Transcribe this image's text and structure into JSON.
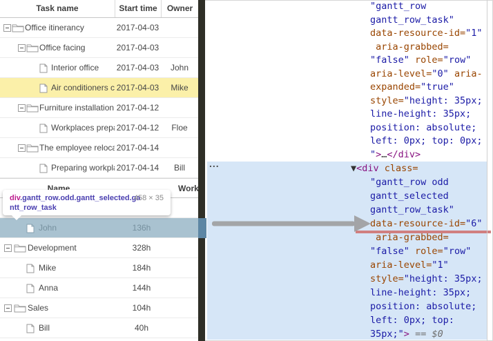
{
  "grid1": {
    "headers": [
      "Task name",
      "Start time",
      "Owner"
    ],
    "rows": [
      {
        "name": "Office itinerancy",
        "level": 0,
        "kind": "folder",
        "start": "2017-04-03",
        "owner": ""
      },
      {
        "name": "Office facing",
        "level": 1,
        "kind": "folder",
        "start": "2017-04-03",
        "owner": ""
      },
      {
        "name": "Interior office",
        "level": 2,
        "kind": "file",
        "start": "2017-04-03",
        "owner": "John"
      },
      {
        "name": "Air conditioners check",
        "level": 2,
        "kind": "file",
        "start": "2017-04-03",
        "owner": "Mike",
        "highlighted": true
      },
      {
        "name": "Furniture installation",
        "level": 1,
        "kind": "folder",
        "start": "2017-04-12",
        "owner": ""
      },
      {
        "name": "Workplaces preparation",
        "level": 2,
        "kind": "file",
        "start": "2017-04-12",
        "owner": "Floe"
      },
      {
        "name": "The employee relocation",
        "level": 1,
        "kind": "folder",
        "start": "2017-04-14",
        "owner": ""
      },
      {
        "name": "Preparing workplace",
        "level": 2,
        "kind": "file",
        "start": "2017-04-14",
        "owner": "Bill"
      }
    ]
  },
  "grid2": {
    "headers": [
      "Name",
      "Workload"
    ],
    "rows": [
      {
        "name": "",
        "kind": "empty",
        "workload": ""
      },
      {
        "name": "John",
        "kind": "file",
        "workload": "136h",
        "selected": true
      },
      {
        "name": "Development",
        "kind": "folder",
        "workload": "328h"
      },
      {
        "name": "Mike",
        "kind": "file",
        "workload": "184h"
      },
      {
        "name": "Anna",
        "kind": "file",
        "workload": "144h"
      },
      {
        "name": "Sales",
        "kind": "folder",
        "workload": "104h"
      },
      {
        "name": "Bill",
        "kind": "file",
        "workload": "40h"
      }
    ]
  },
  "inspect_tooltip": {
    "tag": "div",
    "classes_line1": ".gantt_row.odd.gantt_selected.ga",
    "classes_line2": "ntt_row_task",
    "dimensions": "458 × 35"
  },
  "devtools": {
    "ellipsis": "...",
    "node_above_lines": [
      [
        {
          "t": "\"gantt_row",
          "c": "val"
        }
      ],
      [
        {
          "t": "gantt_row_task\"",
          "c": "val"
        }
      ],
      [
        {
          "t": "data-resource-id=",
          "c": "attr"
        },
        {
          "t": "\"1\"",
          "c": "val"
        }
      ],
      [
        {
          "t": " aria-grabbed=",
          "c": "attr"
        }
      ],
      [
        {
          "t": "\"false\"",
          "c": "val"
        },
        {
          "t": " ",
          "c": "plain"
        },
        {
          "t": "role=",
          "c": "attr"
        },
        {
          "t": "\"row\"",
          "c": "val"
        }
      ],
      [
        {
          "t": "aria-level=",
          "c": "attr"
        },
        {
          "t": "\"0\"",
          "c": "val"
        },
        {
          "t": " ",
          "c": "plain"
        },
        {
          "t": "aria-",
          "c": "attr"
        }
      ],
      [
        {
          "t": "expanded=",
          "c": "attr"
        },
        {
          "t": "\"true\"",
          "c": "val"
        }
      ],
      [
        {
          "t": "style=",
          "c": "attr"
        },
        {
          "t": "\"height: 35px;",
          "c": "val"
        }
      ],
      [
        {
          "t": "line-height: 35px;",
          "c": "val"
        }
      ],
      [
        {
          "t": "position: absolute;",
          "c": "val"
        }
      ],
      [
        {
          "t": "left: 0px; top: 0px;",
          "c": "val"
        }
      ],
      [
        {
          "t": "\"",
          "c": "val"
        },
        {
          "t": ">",
          "c": "tag"
        },
        {
          "t": "…",
          "c": "plain"
        },
        {
          "t": "</div>",
          "c": "tag"
        }
      ]
    ],
    "selected_node_lines": [
      [
        {
          "t": "▼",
          "c": "plain"
        },
        {
          "t": "<div ",
          "c": "tag"
        },
        {
          "t": "class=",
          "c": "attr"
        }
      ],
      [
        {
          "t": "\"gantt_row odd",
          "c": "val"
        }
      ],
      [
        {
          "t": "gantt_selected",
          "c": "val"
        }
      ],
      [
        {
          "t": "gantt_row_task\"",
          "c": "val"
        }
      ],
      [
        {
          "t": "data-resource-id=",
          "c": "attr"
        },
        {
          "t": "\"6\"",
          "c": "val"
        }
      ],
      [
        {
          "t": " aria-grabbed=",
          "c": "attr"
        }
      ],
      [
        {
          "t": "\"false\"",
          "c": "val"
        },
        {
          "t": " ",
          "c": "plain"
        },
        {
          "t": "role=",
          "c": "attr"
        },
        {
          "t": "\"row\"",
          "c": "val"
        }
      ],
      [
        {
          "t": "aria-level=",
          "c": "attr"
        },
        {
          "t": "\"1\"",
          "c": "val"
        }
      ],
      [
        {
          "t": "style=",
          "c": "attr"
        },
        {
          "t": "\"height: 35px;",
          "c": "val"
        }
      ],
      [
        {
          "t": "line-height: 35px;",
          "c": "val"
        }
      ],
      [
        {
          "t": "position: absolute;",
          "c": "val"
        }
      ],
      [
        {
          "t": "left: 0px; top:",
          "c": "val"
        }
      ],
      [
        {
          "t": "35px;\"",
          "c": "val"
        },
        {
          "t": ">",
          "c": "tag"
        },
        {
          "t": " ",
          "c": "plain"
        },
        {
          "t": "== $0",
          "c": "marker"
        }
      ]
    ],
    "underline_line_index": 4
  },
  "colors": {
    "attr_name": "#994500",
    "attr_value": "#1a1aa6",
    "tag": "#881280",
    "selected_node_bg": "#d6e6f7",
    "row_highlight_yellow": "#fbf0a9",
    "row_selected_blue": "#a9c2d0",
    "underline_red": "#d07f7f",
    "arrow_gray": "#9c9c9c",
    "splitter": "#2f2f27"
  }
}
